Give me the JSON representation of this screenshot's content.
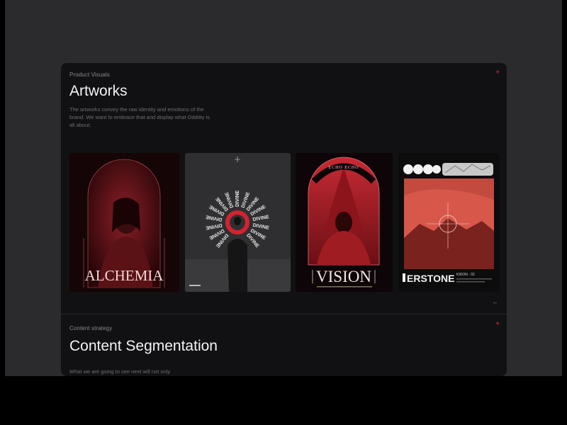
{
  "colors": {
    "accent": "#e4303c",
    "background": "#2b2b2d",
    "card": "#111113",
    "title_text": "#f3f3f5",
    "muted_text": "#6e6e74"
  },
  "artworks_section": {
    "eyebrow": "Product Visuals",
    "plus_icon": "+",
    "title": "Artworks",
    "description": "The artworks convey the raw identity and emotions of the brand. We want to embrace that and display what Odditty is all about.",
    "pager": "»»"
  },
  "artworks": [
    {
      "title": "ALCHEMIA"
    },
    {
      "repeated_word": "DIVINE"
    },
    {
      "top_text": "ECHO ECHO",
      "title": "VISION"
    },
    {
      "title": "ERSTONE",
      "caption": "KIDON · 02"
    }
  ],
  "content_section": {
    "eyebrow": "Content strategy",
    "plus_icon": "+",
    "title": "Content Segmentation",
    "description": "What we are going to see next will not only"
  }
}
